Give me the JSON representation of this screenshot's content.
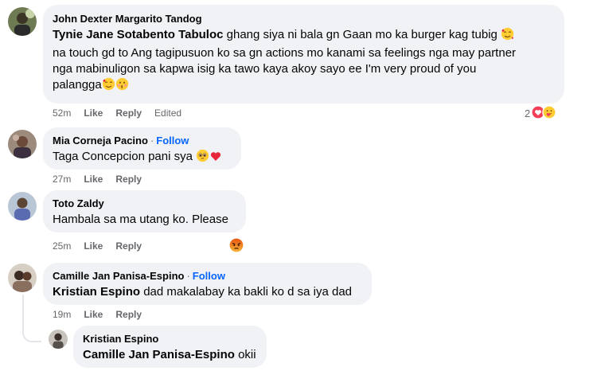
{
  "comments": [
    {
      "author": "John Dexter Margarito Tandog",
      "mention": "Tynie Jane Sotabento Tabuloc",
      "lines": [
        "ghang siya ni bala gn Gaan mo ka burger kag tubig",
        "na touch gd to Ang tagipusuon ko sa gn actions mo kanami sa feelings nga may partner",
        "nga mabinuligon sa kapwa isig ka tawo kaya akoy sayo ee I'm very proud of you",
        "palangga"
      ],
      "time": "52m",
      "like": "Like",
      "reply": "Reply",
      "edited": "Edited",
      "reaction_count": "2"
    },
    {
      "author": "Mia Corneja Pacino",
      "follow": "Follow",
      "text": "Taga Concepcion pani sya",
      "time": "27m",
      "like": "Like",
      "reply": "Reply"
    },
    {
      "author": "Toto Zaldy",
      "text": "Hambala sa ma utang ko. Please",
      "time": "25m",
      "like": "Like",
      "reply": "Reply"
    },
    {
      "author": "Camille Jan Panisa-Espino",
      "follow": "Follow",
      "mention": "Kristian Espino",
      "text": "dad makalabay ka bakli ko d sa iya dad",
      "time": "19m",
      "like": "Like",
      "reply": "Reply"
    },
    {
      "author": "Kristian Espino",
      "mention": "Camille Jan Panisa-Espino",
      "text": "okii"
    }
  ],
  "separator_dot": "·",
  "colors": {
    "bubble": "#f0f2f5",
    "link": "#0866ff",
    "meta": "#65676b",
    "love": "#f33e58",
    "angry": "#e9710f"
  }
}
